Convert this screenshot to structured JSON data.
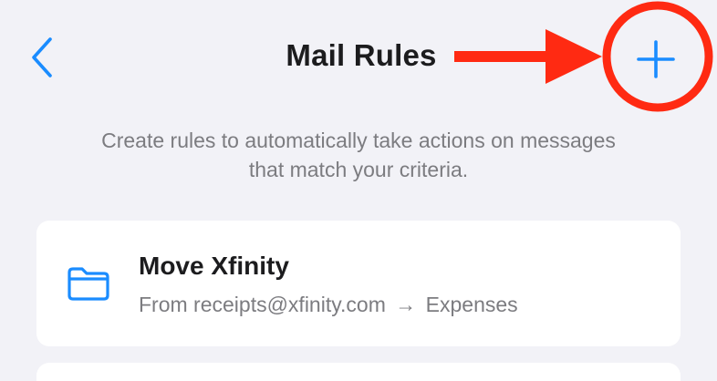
{
  "header": {
    "title": "Mail Rules",
    "back_icon": "chevron-left-icon",
    "add_icon": "plus-icon"
  },
  "annotation": {
    "arrow_icon": "right-arrow-icon",
    "circle_icon": "highlight-circle-icon",
    "color": "#ff2a12"
  },
  "description": {
    "line1": "Create rules to automatically take actions on messages",
    "line2": "that match your criteria."
  },
  "rules": [
    {
      "name": "Move Xfinity",
      "icon": "folder-icon",
      "from": "From receipts@xfinity.com",
      "arrow": "→",
      "destination": "Expenses"
    }
  ],
  "colors": {
    "accent": "#1a8cff",
    "background": "#f2f2f7",
    "card": "#ffffff",
    "primary_text": "#1c1c1e",
    "secondary_text": "#7c7c80"
  }
}
